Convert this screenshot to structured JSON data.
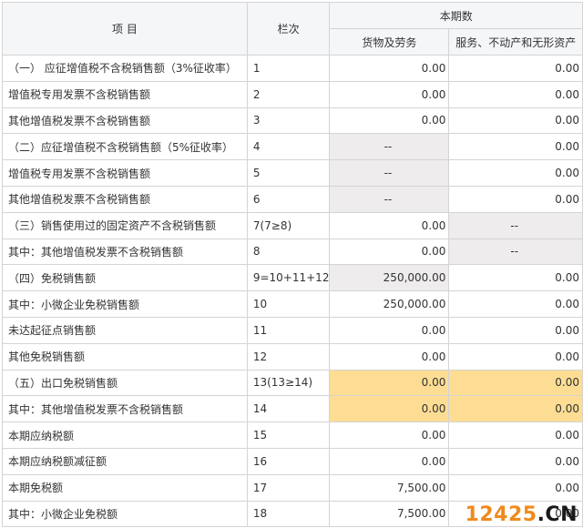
{
  "header": {
    "item": "项 目",
    "col": "栏次",
    "period": "本期数",
    "goods": "货物及劳务",
    "services": "服务、不动产和无形资产"
  },
  "rows": [
    {
      "item": "（一） 应征增值税不含税销售额（3%征收率）",
      "col": "1",
      "goods": "0.00",
      "services": "0.00",
      "goods_bg": "white",
      "services_bg": "white"
    },
    {
      "item": "增值税专用发票不含税销售额",
      "col": "2",
      "goods": "0.00",
      "services": "0.00",
      "goods_bg": "white",
      "services_bg": "white"
    },
    {
      "item": "其他增值税发票不含税销售额",
      "col": "3",
      "goods": "0.00",
      "services": "0.00",
      "goods_bg": "white",
      "services_bg": "white"
    },
    {
      "item": "（二）应征增值税不含税销售额（5%征收率）",
      "col": "4",
      "goods": "--",
      "services": "0.00",
      "goods_bg": "grey",
      "services_bg": "white"
    },
    {
      "item": "增值税专用发票不含税销售额",
      "col": "5",
      "goods": "--",
      "services": "0.00",
      "goods_bg": "grey",
      "services_bg": "white"
    },
    {
      "item": "其他增值税发票不含税销售额",
      "col": "6",
      "goods": "--",
      "services": "0.00",
      "goods_bg": "grey",
      "services_bg": "white"
    },
    {
      "item": "（三）销售使用过的固定资产不含税销售额",
      "col": "7(7≥8)",
      "goods": "0.00",
      "services": "--",
      "goods_bg": "white",
      "services_bg": "grey"
    },
    {
      "item": "其中：其他增值税发票不含税销售额",
      "col": "8",
      "goods": "0.00",
      "services": "--",
      "goods_bg": "white",
      "services_bg": "grey"
    },
    {
      "item": "（四）免税销售额",
      "col": "9=10+11+12",
      "goods": "250,000.00",
      "services": "0.00",
      "goods_bg": "grey",
      "services_bg": "white"
    },
    {
      "item": "其中：小微企业免税销售额",
      "col": "10",
      "goods": "250,000.00",
      "services": "0.00",
      "goods_bg": "white",
      "services_bg": "white"
    },
    {
      "item": "未达起征点销售额",
      "col": "11",
      "goods": "0.00",
      "services": "0.00",
      "goods_bg": "white",
      "services_bg": "white"
    },
    {
      "item": "其他免税销售额",
      "col": "12",
      "goods": "0.00",
      "services": "0.00",
      "goods_bg": "white",
      "services_bg": "white"
    },
    {
      "item": "（五）出口免税销售额",
      "col": "13(13≥14)",
      "goods": "0.00",
      "services": "0.00",
      "goods_bg": "highlight",
      "services_bg": "highlight"
    },
    {
      "item": "其中：其他增值税发票不含税销售额",
      "col": "14",
      "goods": "0.00",
      "services": "0.00",
      "goods_bg": "highlight",
      "services_bg": "highlight"
    },
    {
      "item": "本期应纳税额",
      "col": "15",
      "goods": "0.00",
      "services": "0.00",
      "goods_bg": "white",
      "services_bg": "white"
    },
    {
      "item": "本期应纳税额减征额",
      "col": "16",
      "goods": "0.00",
      "services": "0.00",
      "goods_bg": "white",
      "services_bg": "white"
    },
    {
      "item": "本期免税额",
      "col": "17",
      "goods": "7,500.00",
      "services": "0.00",
      "goods_bg": "white",
      "services_bg": "white"
    },
    {
      "item": "其中：小微企业免税额",
      "col": "18",
      "goods": "7,500.00",
      "services": "0.00",
      "goods_bg": "white",
      "services_bg": "white"
    }
  ],
  "colors": {
    "grey": "#eeecec",
    "highlight": "#fcdd93",
    "watermark_digits": "#f08a1c",
    "watermark_dot": "#1a1a1a"
  },
  "watermark": {
    "digits": "12425",
    "dot": ".CN"
  }
}
